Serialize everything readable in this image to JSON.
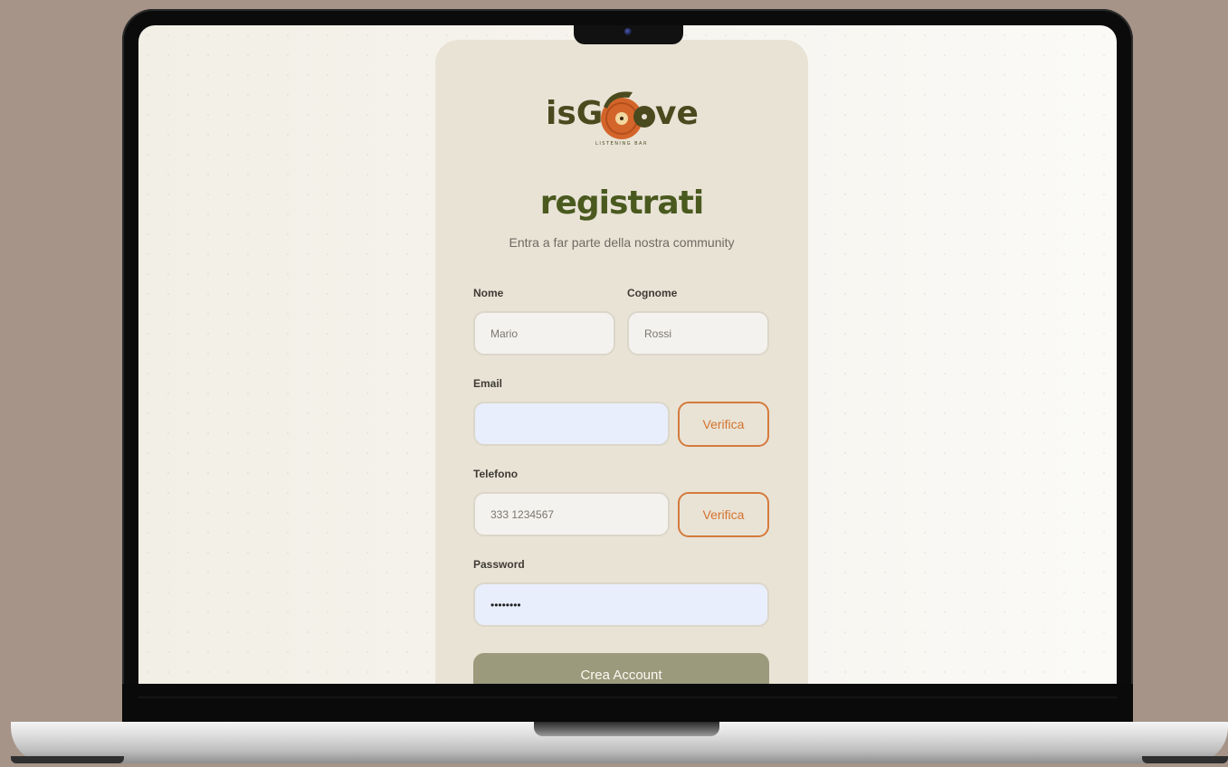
{
  "brand": {
    "logo_text": "isGroove",
    "logo_tagline": "LISTENING BAR"
  },
  "form": {
    "title": "registrati",
    "subtitle": "Entra a far parte della nostra community",
    "nome": {
      "label": "Nome",
      "value": "Mario"
    },
    "cognome": {
      "label": "Cognome",
      "value": "Rossi"
    },
    "email": {
      "label": "Email",
      "value": "",
      "verify_label": "Verifica"
    },
    "telefono": {
      "label": "Telefono",
      "value": "333 1234567",
      "verify_label": "Verifica"
    },
    "password": {
      "label": "Password",
      "masked_value": "••••••••"
    },
    "submit_label": "Crea Account"
  },
  "colors": {
    "accent_orange": "#d4732e",
    "title_green": "#4a5a1f",
    "card_bg": "#e9e3d6",
    "button_bg": "#9b9a7c"
  }
}
